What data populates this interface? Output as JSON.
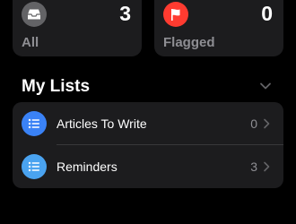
{
  "colors": {
    "background": "#000000",
    "card": "#1c1c1e",
    "secondary_text": "#8e8e93",
    "all_icon": "#636366",
    "flag_icon": "#ff3b30",
    "list_icon_1": "#3a82f6",
    "list_icon_2": "#4aa3f0"
  },
  "summary": {
    "all": {
      "count": "3",
      "label": "All",
      "icon": "tray-icon"
    },
    "flagged": {
      "count": "0",
      "label": "Flagged",
      "icon": "flag-icon"
    }
  },
  "my_lists": {
    "title": "My Lists",
    "collapse_icon": "chevron-down-icon",
    "items": [
      {
        "name": "Articles To Write",
        "count": "0",
        "icon": "list-bullet-icon"
      },
      {
        "name": "Reminders",
        "count": "3",
        "icon": "list-bullet-icon"
      }
    ]
  }
}
